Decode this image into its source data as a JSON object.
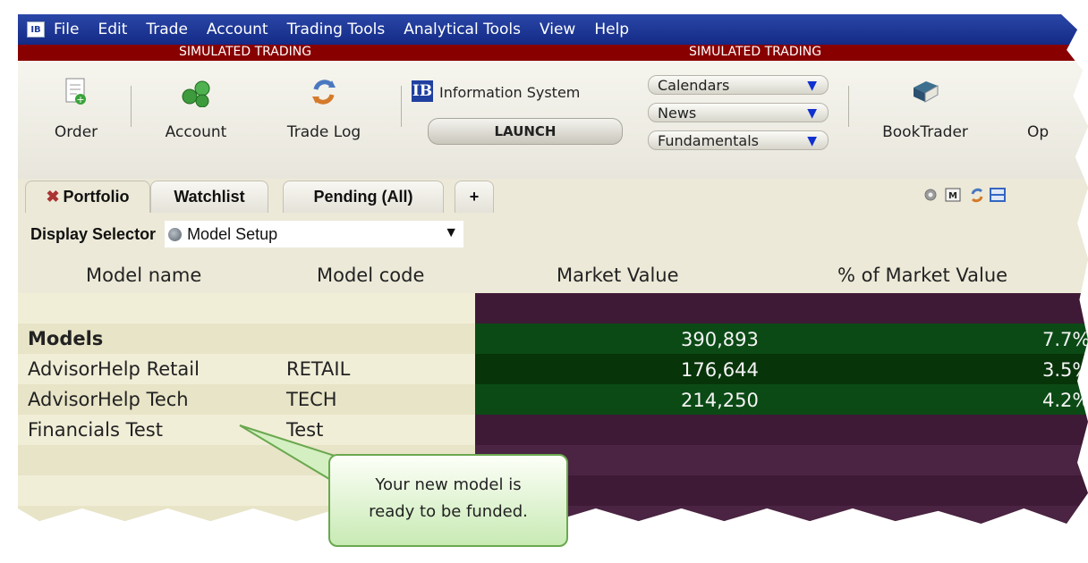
{
  "app": {
    "icon_label": "IB"
  },
  "menu": [
    "File",
    "Edit",
    "Trade",
    "Account",
    "Trading Tools",
    "Analytical Tools",
    "View",
    "Help"
  ],
  "banner": {
    "left": "SIMULATED TRADING",
    "right": "SIMULATED TRADING"
  },
  "toolbar": {
    "order": "Order",
    "account": "Account",
    "trade_log": "Trade Log",
    "ib_box": "IB",
    "info_system": "Information System",
    "launch": "LAUNCH",
    "calendars": "Calendars",
    "news": "News",
    "fundamentals": "Fundamentals",
    "booktrader": "BookTrader",
    "cut_off_item": "Op"
  },
  "tabs": {
    "portfolio": "Portfolio",
    "watchlist": "Watchlist",
    "pending": "Pending (All)",
    "add": "+"
  },
  "display_selector": {
    "label": "Display Selector",
    "value": "Model Setup"
  },
  "table": {
    "columns": [
      "Model name",
      "Model code",
      "Market Value",
      "% of Market Value"
    ],
    "rows": [
      {
        "name": "",
        "code": "",
        "market_value": "",
        "pct": ""
      },
      {
        "name": "Models",
        "code": "",
        "market_value": "390,893",
        "pct": "7.7%"
      },
      {
        "name": "AdvisorHelp Retail",
        "code": "RETAIL",
        "market_value": "176,644",
        "pct": "3.5%"
      },
      {
        "name": "AdvisorHelp Tech",
        "code": "TECH",
        "market_value": "214,250",
        "pct": "4.2%"
      },
      {
        "name": "Financials Test",
        "code": "Test",
        "market_value": "",
        "pct": ""
      }
    ]
  },
  "callout": {
    "line1": "Your new model is",
    "line2": "ready to be funded."
  },
  "colors": {
    "menubar": "#1a3598",
    "banner": "#880000",
    "left_panel": "#efebd4",
    "right_panel": "#3e1a36",
    "green_row": "#0b4a15",
    "green_row_dark": "#073409"
  }
}
